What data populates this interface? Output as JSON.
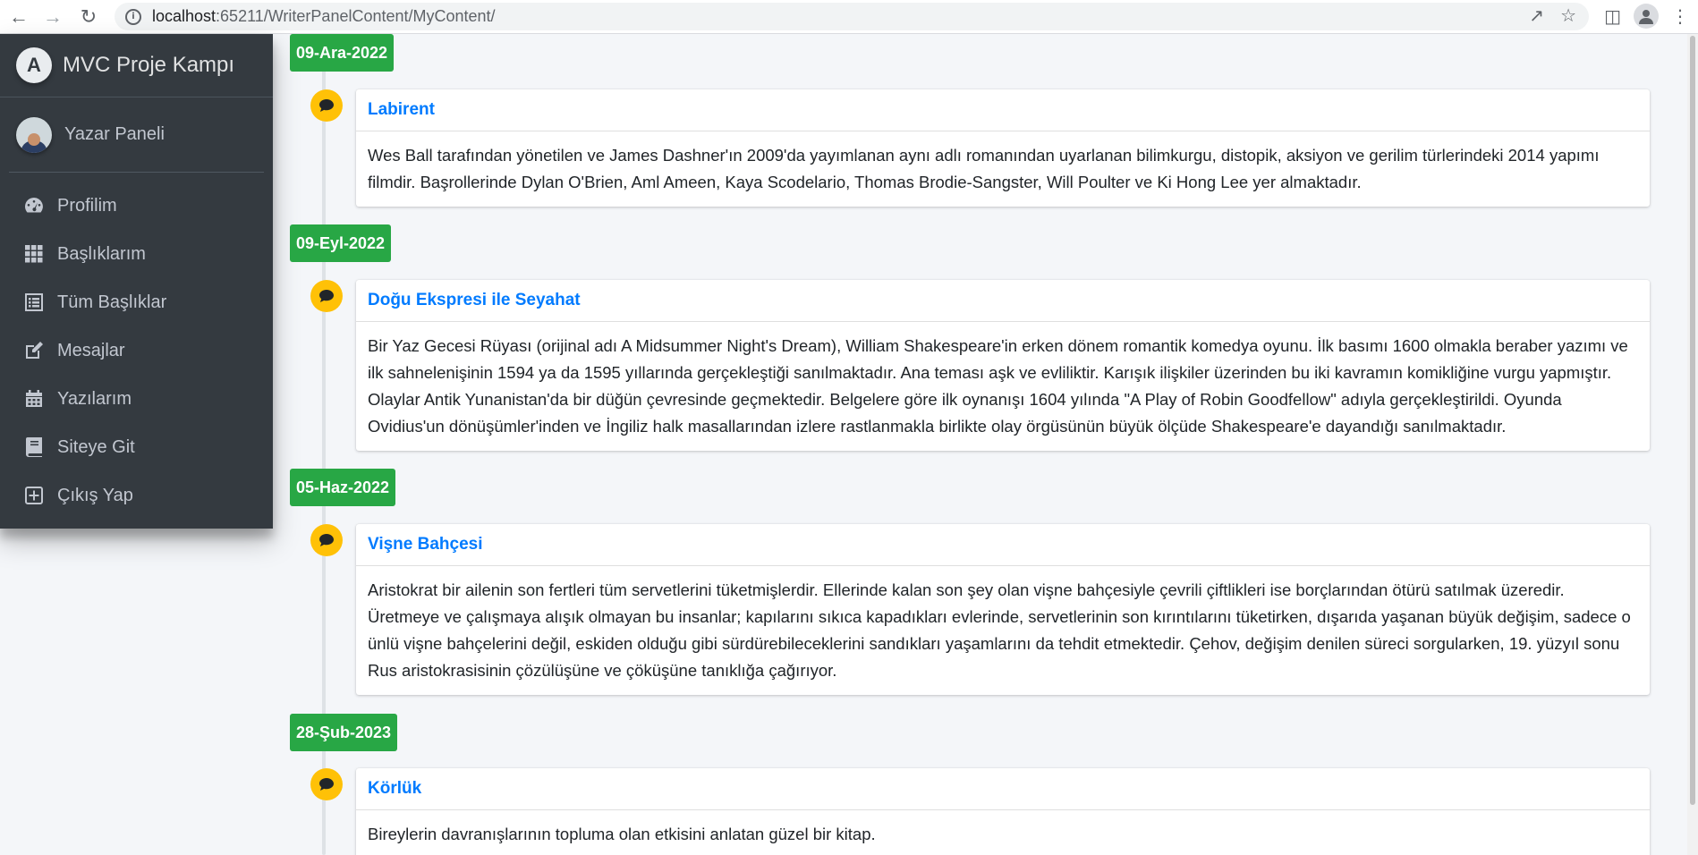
{
  "browser": {
    "url_host": "localhost",
    "url_path": ":65211/WriterPanelContent/MyContent/"
  },
  "sidebar": {
    "brand": "MVC Proje Kampı",
    "brand_logo_letter": "A",
    "user_name": "Yazar Paneli",
    "items": [
      {
        "label": "Profilim",
        "icon": "dashboard-icon"
      },
      {
        "label": "Başlıklarım",
        "icon": "grid-icon"
      },
      {
        "label": "Tüm Başlıklar",
        "icon": "list-icon"
      },
      {
        "label": "Mesajlar",
        "icon": "edit-icon"
      },
      {
        "label": "Yazılarım",
        "icon": "calendar-icon"
      },
      {
        "label": "Siteye Git",
        "icon": "book-icon"
      },
      {
        "label": "Çıkış Yap",
        "icon": "plus-square-icon"
      }
    ]
  },
  "timeline": [
    {
      "date": "09-Ara-2022",
      "title": "Labirent",
      "body": "Wes Ball tarafından yönetilen ve James Dashner'ın 2009'da yayımlanan aynı adlı romanından uyarlanan bilimkurgu, distopik, aksiyon ve gerilim türlerindeki 2014 yapımı filmdir. Başrollerinde Dylan O'Brien, Aml Ameen, Kaya Scodelario, Thomas Brodie-Sangster, Will Poulter ve Ki Hong Lee yer almaktadır."
    },
    {
      "date": "09-Eyl-2022",
      "title": "Doğu Ekspresi ile Seyahat",
      "body": "Bir Yaz Gecesi Rüyası (orijinal adı A Midsummer Night's Dream), William Shakespeare'in erken dönem romantik komedya oyunu. İlk basımı 1600 olmakla beraber yazımı ve ilk sahnelenişinin 1594 ya da 1595 yıllarında gerçekleştiği sanılmaktadır. Ana teması aşk ve evliliktir. Karışık ilişkiler üzerinden bu iki kavramın komikliğine vurgu yapmıştır. Olaylar Antik Yunanistan'da bir düğün çevresinde geçmektedir. Belgelere göre ilk oynanışı 1604 yılında \"A Play of Robin Goodfellow\" adıyla gerçekleştirildi. Oyunda Ovidius'un dönüşümler'inden ve İngiliz halk masallarından izlere rastlanmakla birlikte olay örgüsünün büyük ölçüde Shakespeare'e dayandığı sanılmaktadır."
    },
    {
      "date": "05-Haz-2022",
      "title": "Vişne Bahçesi",
      "body": "Aristokrat bir ailenin son fertleri tüm servetlerini tüketmişlerdir. Ellerinde kalan son şey olan vişne bahçesiyle çevrili çiftlikleri ise borçlarından ötürü satılmak üzeredir. Üretmeye ve çalışmaya alışık olmayan bu insanlar; kapılarını sıkıca kapadıkları evlerinde, servetlerinin son kırıntılarını tüketirken, dışarıda yaşanan büyük değişim, sadece o ünlü vişne bahçelerini değil, eskiden olduğu gibi sürdürebileceklerini sandıkları yaşamlarını da tehdit etmektedir. Çehov, değişim denilen süreci sorgularken, 19. yüzyıl sonu Rus aristokrasisinin çözülüşüne ve çöküşüne tanıklığa çağırıyor."
    },
    {
      "date": "28-Şub-2023",
      "title": "Körlük",
      "body": "Bireylerin davranışlarının topluma olan etkisini anlatan güzel bir kitap."
    }
  ],
  "colors": {
    "sidebar_bg": "#343a40",
    "date_badge": "#28a745",
    "timeline_icon": "#ffc107",
    "title_link": "#007bff"
  }
}
